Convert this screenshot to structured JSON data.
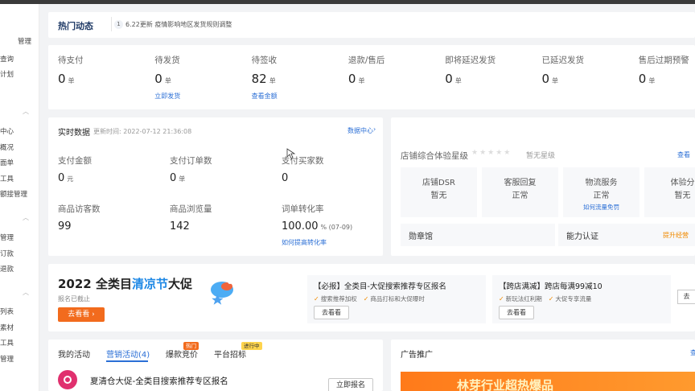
{
  "sidebar": {
    "items": [
      "管理",
      "查询",
      "计划",
      "中心",
      "概况",
      "面单",
      "工具",
      "额接管理",
      "管理",
      "订款",
      "退款",
      "列表",
      "素材",
      "工具",
      "管理"
    ]
  },
  "header": {
    "title": "热门动态",
    "notice_index": "1",
    "notice_text": "6.22更新 疫情影响地区发货规则调整"
  },
  "orders": [
    {
      "label": "待支付",
      "value": "0",
      "unit": "单",
      "link": ""
    },
    {
      "label": "待发货",
      "value": "0",
      "unit": "单",
      "link": "立即发货"
    },
    {
      "label": "待签收",
      "value": "82",
      "unit": "单",
      "link": "查看金额"
    },
    {
      "label": "退款/售后",
      "value": "0",
      "unit": "单",
      "link": ""
    },
    {
      "label": "即将延迟发货",
      "value": "0",
      "unit": "单",
      "link": ""
    },
    {
      "label": "已延迟发货",
      "value": "0",
      "unit": "单",
      "link": ""
    },
    {
      "label": "售后过期预警",
      "value": "0",
      "unit": "单",
      "link": ""
    }
  ],
  "realtime": {
    "title": "实时数据",
    "update_time": "更新时间: 2022-07-12 21:36:08",
    "center_link": "数据中心",
    "metrics": [
      {
        "label": "支付金额",
        "value": "0",
        "unit": "元"
      },
      {
        "label": "支付订单数",
        "value": "0",
        "unit": "单"
      },
      {
        "label": "支付买家数",
        "value": "0",
        "unit": ""
      },
      {
        "label": "商品访客数",
        "value": "99",
        "unit": ""
      },
      {
        "label": "商品浏览量",
        "value": "142",
        "unit": ""
      },
      {
        "label": "词单转化率",
        "value": "100.00",
        "unit": "% (07-09)"
      }
    ],
    "convert_link": "如何提高转化率"
  },
  "store": {
    "rating_label": "店铺综合体验星级",
    "rating_value": "暂无星级",
    "view_link": "查看",
    "cells": [
      {
        "label": "店铺DSR",
        "value": "暂无",
        "link": ""
      },
      {
        "label": "客服回复",
        "value": "正常",
        "link": ""
      },
      {
        "label": "物流服务",
        "value": "正常",
        "link": "如何流量免罚"
      },
      {
        "label": "体验分",
        "value": "暂无",
        "link": ""
      }
    ],
    "medal_label": "勋章馆",
    "ability_label": "能力认证",
    "ability_link": "提升经营"
  },
  "promo": {
    "title_a": "2022 全类目",
    "title_b": "清凉节",
    "title_c": "大促",
    "deadline": "报名已截止",
    "button": "去看看",
    "cards": [
      {
        "title": "【必报】全类目-大促搜索推荐专区报名",
        "tags": [
          "搜索推荐加权",
          "商品打标和大促曝时"
        ],
        "button": "去看看"
      },
      {
        "title": "【跨店满减】跨店每满99减10",
        "tags": [
          "新玩法红利期",
          "大促专享流量"
        ],
        "button": "去看看"
      }
    ]
  },
  "activity": {
    "tabs": [
      "我的活动",
      "营销活动(4)",
      "爆款竞价",
      "平台招标"
    ],
    "badges": [
      "热门",
      "进行中"
    ],
    "item_title": "夏清仓大促-全类目搜索推荐专区报名",
    "item_button": "立即报名"
  },
  "ads": {
    "title": "广告推广",
    "banner_text": "林芽行业超热爆品"
  },
  "colors": {
    "accent": "#2b6fd6",
    "orange": "#f26b1d",
    "pink": "#e0306e"
  }
}
